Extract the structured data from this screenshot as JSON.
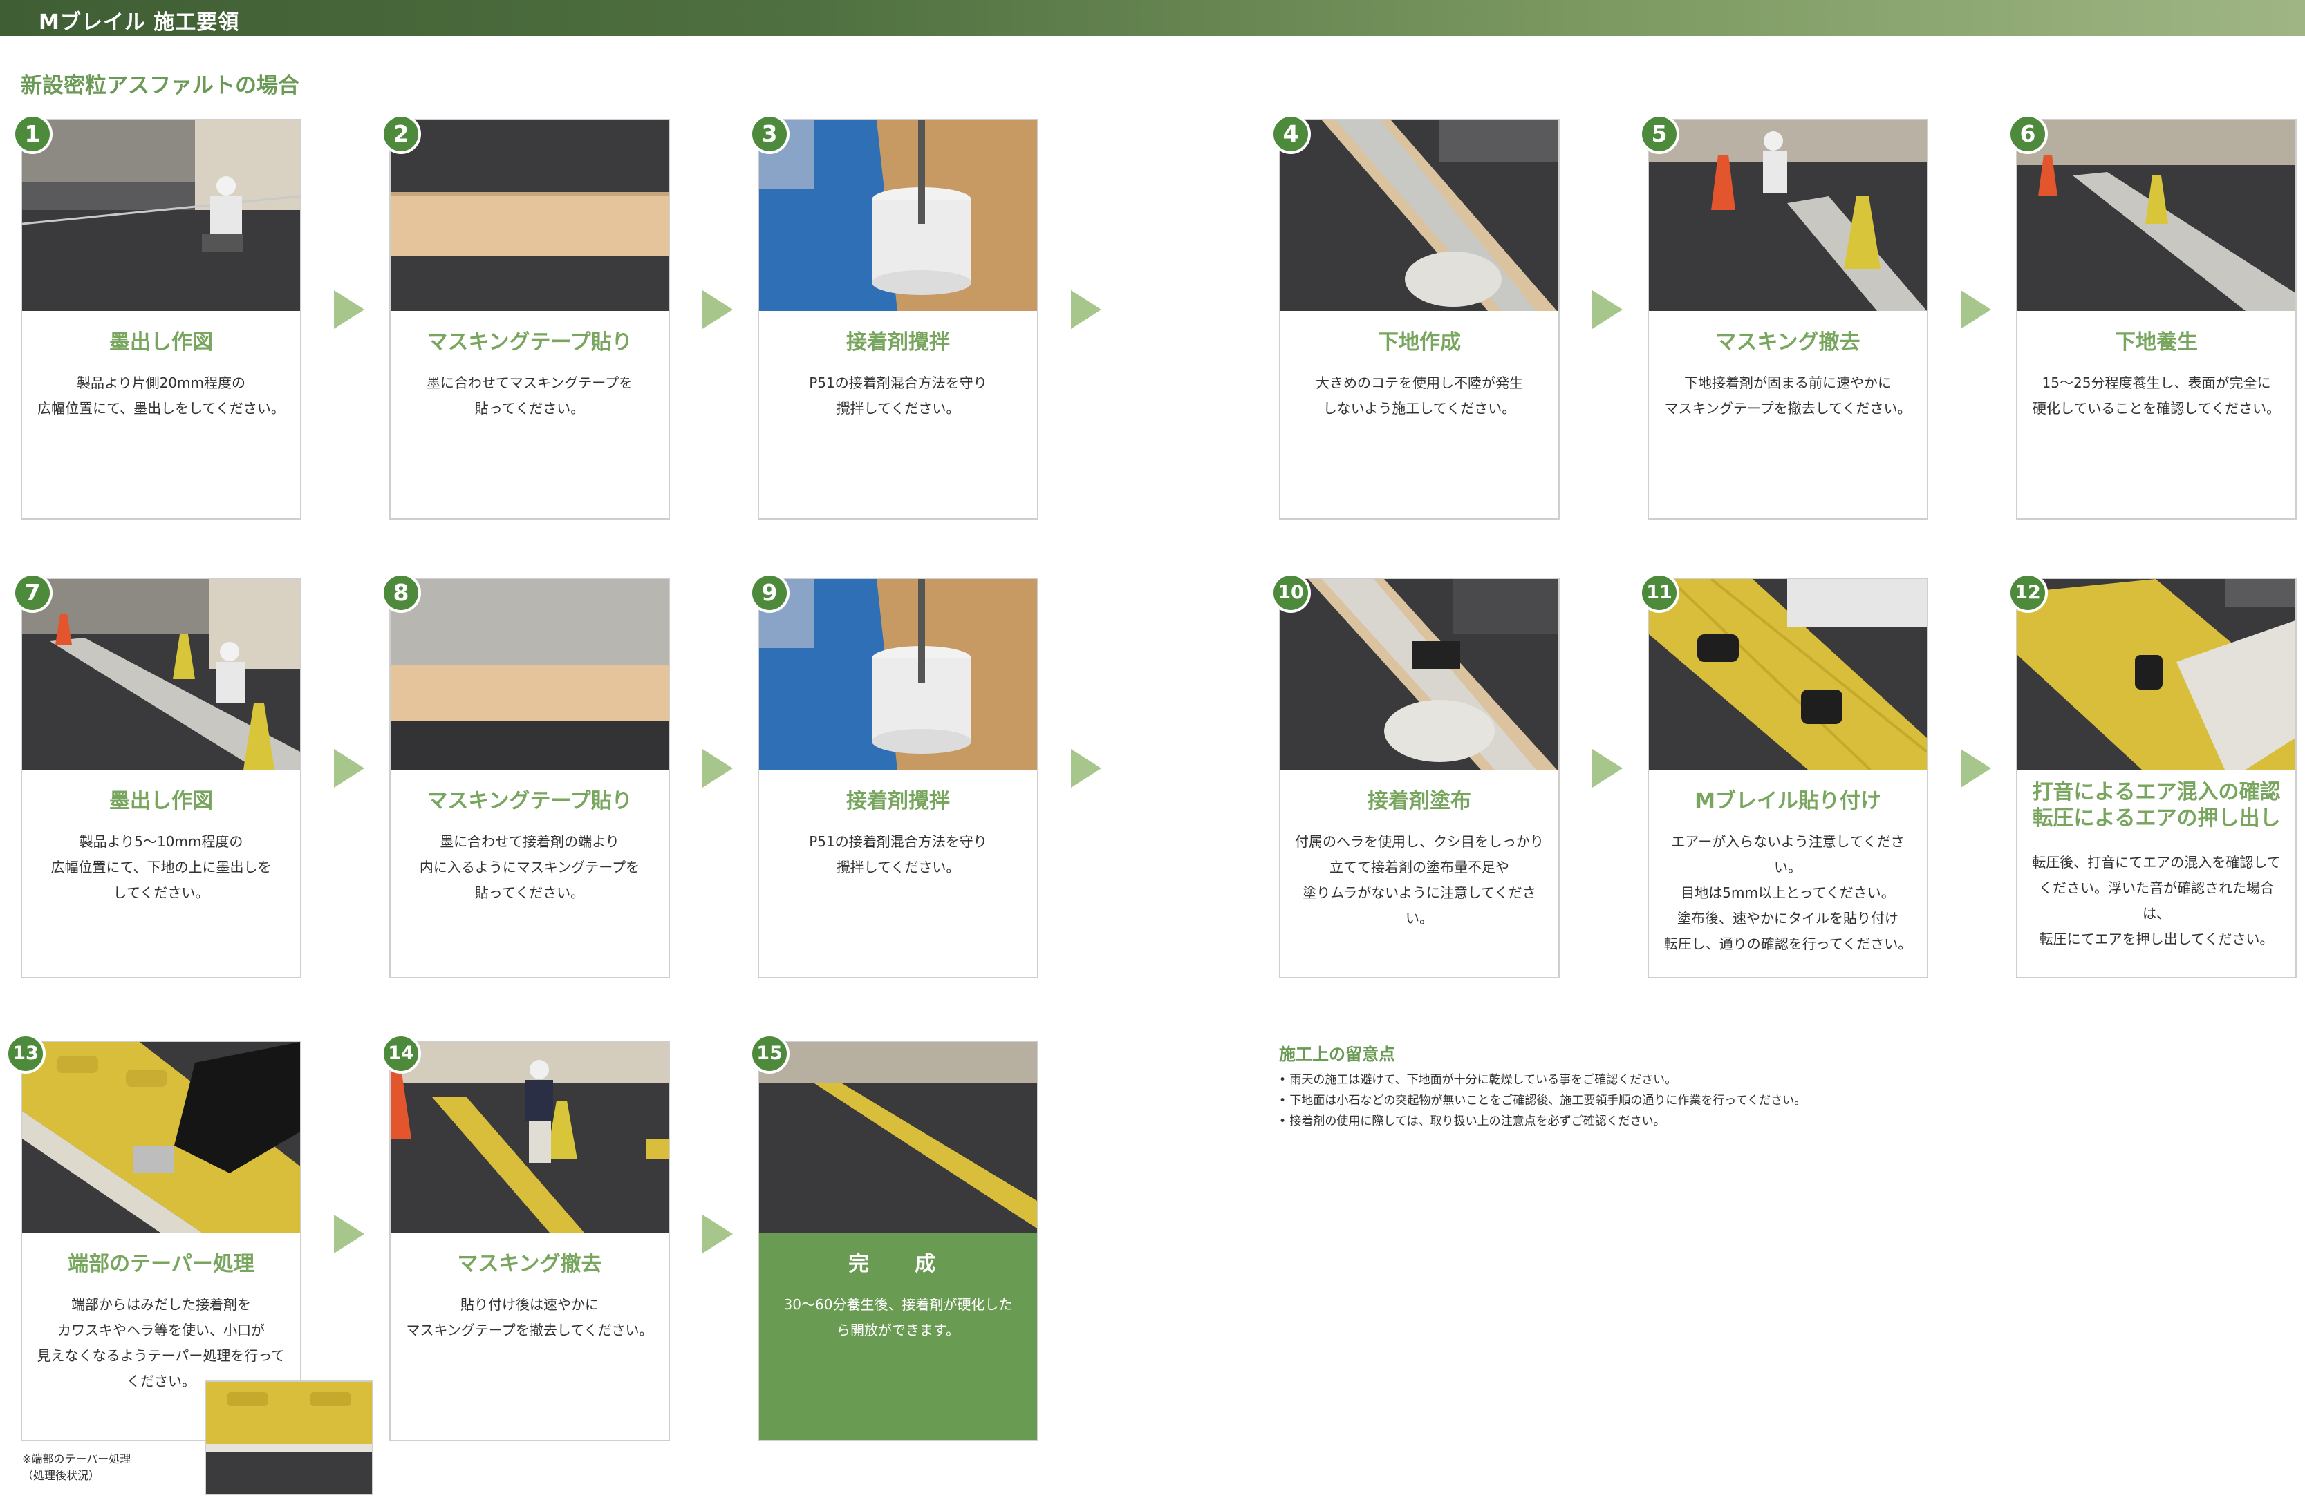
{
  "header": {
    "title": "Mブレイル 施工要領"
  },
  "section": {
    "title": "新設密粒アスファルトの場合"
  },
  "steps": [
    {
      "num": "1",
      "title": "墨出し作図",
      "desc": "製品より片側20mm程度の\n広幅位置にて、墨出しをしてください。"
    },
    {
      "num": "2",
      "title": "マスキングテープ貼り",
      "desc": "墨に合わせてマスキングテープを\n貼ってください。"
    },
    {
      "num": "3",
      "title": "接着剤攪拌",
      "desc": "P51の接着剤混合方法を守り\n攪拌してください。"
    },
    {
      "num": "4",
      "title": "下地作成",
      "desc": "大きめのコテを使用し不陸が発生\nしないよう施工してください。"
    },
    {
      "num": "5",
      "title": "マスキング撤去",
      "desc": "下地接着剤が固まる前に速やかに\nマスキングテープを撤去してください。"
    },
    {
      "num": "6",
      "title": "下地養生",
      "desc": "15〜25分程度養生し、表面が完全に\n硬化していることを確認してください。"
    },
    {
      "num": "7",
      "title": "墨出し作図",
      "desc": "製品より5〜10mm程度の\n広幅位置にて、下地の上に墨出しを\nしてください。"
    },
    {
      "num": "8",
      "title": "マスキングテープ貼り",
      "desc": "墨に合わせて接着剤の端より\n内に入るようにマスキングテープを\n貼ってください。"
    },
    {
      "num": "9",
      "title": "接着剤攪拌",
      "desc": "P51の接着剤混合方法を守り\n攪拌してください。"
    },
    {
      "num": "10",
      "title": "接着剤塗布",
      "desc": "付属のヘラを使用し、クシ目をしっかり\n立てて接着剤の塗布量不足や\n塗りムラがないように注意してください。"
    },
    {
      "num": "11",
      "title": "Mブレイル貼り付け",
      "desc": "エアーが入らないよう注意してください。\n目地は5mm以上とってください。\n塗布後、速やかにタイルを貼り付け\n転圧し、通りの確認を行ってください。"
    },
    {
      "num": "12",
      "title": "打音によるエア混入の確認\n転圧によるエアの押し出し",
      "desc": "転圧後、打音にてエアの混入を確認して\nください。浮いた音が確認された場合は、\n転圧にてエアを押し出してください。"
    },
    {
      "num": "13",
      "title": "端部のテーパー処理",
      "desc": "端部からはみだした接着剤を\nカワスキやヘラ等を使い、小口が\n見えなくなるようテーパー処理を行って\nください。"
    },
    {
      "num": "14",
      "title": "マスキング撤去",
      "desc": "貼り付け後は速やかに\nマスキングテープを撤去してください。"
    },
    {
      "num": "15",
      "title": "完　成",
      "desc": "30〜60分養生後、接着剤が硬化した\nら開放ができます。"
    }
  ],
  "inset": {
    "caption": "※端部のテーパー処理\n（処理後状況）"
  },
  "notes": {
    "title": "施工上の留意点",
    "items": [
      "• 雨天の施工は避けて、下地面が十分に乾燥している事をご確認ください。",
      "• 下地面は小石などの突起物が無いことをご確認後、施工要領手順の通りに作業を行ってください。",
      "• 接着剤の使用に際しては、取り扱い上の注意点を必ずご確認ください。"
    ]
  },
  "colors": {
    "header": "#4f7040",
    "accent_green": "#78a65e",
    "badge": "#4d8a3c",
    "complete_panel": "#6a9b52",
    "arrow": "#a7c68c",
    "braille_yellow": "#d8be3a"
  }
}
